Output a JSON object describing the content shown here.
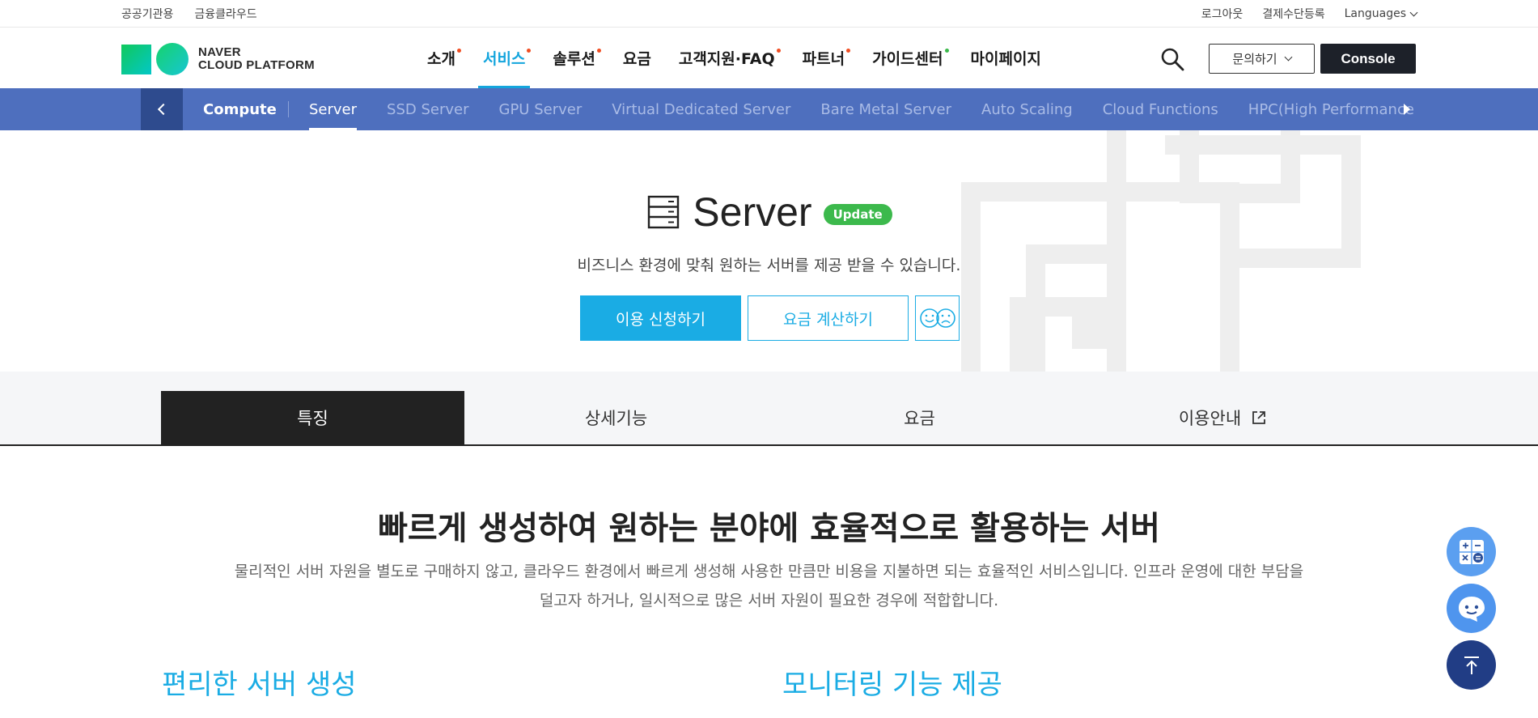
{
  "util": {
    "left": [
      "공공기관용",
      "금융클라우드"
    ],
    "right": [
      "로그아웃",
      "결제수단등록"
    ],
    "languages": "Languages"
  },
  "logo": {
    "line1": "NAVER",
    "line2": "CLOUD PLATFORM"
  },
  "gnb": [
    {
      "label": "소개",
      "dot": "#f04e23"
    },
    {
      "label": "서비스",
      "dot": "#f04e23",
      "active": true
    },
    {
      "label": "솔루션",
      "dot": "#f04e23"
    },
    {
      "label": "요금"
    },
    {
      "label": "고객지원·FAQ",
      "dot": "#f04e23"
    },
    {
      "label": "파트너",
      "dot": "#f04e23"
    },
    {
      "label": "가이드센터",
      "dot": "#3cb94c"
    },
    {
      "label": "마이페이지"
    }
  ],
  "header": {
    "inquiry": "문의하기",
    "console": "Console"
  },
  "subnav": {
    "category": "Compute",
    "items": [
      "Server",
      "SSD Server",
      "GPU Server",
      "Virtual Dedicated Server",
      "Bare Metal Server",
      "Auto Scaling",
      "Cloud Functions",
      "HPC(High Performance"
    ],
    "active": "Server"
  },
  "hero": {
    "title": "Server",
    "badge": "Update",
    "desc": "비즈니스 환경에 맞춰 원하는 서버를 제공 받을 수 있습니다.",
    "apply": "이용 신청하기",
    "calc": "요금 계산하기"
  },
  "tabs": [
    "특징",
    "상세기능",
    "요금",
    "이용안내"
  ],
  "content": {
    "headline": "빠르게 생성하여 원하는 분야에 효율적으로 활용하는 서버",
    "lead": "물리적인 서버 자원을 별도로 구매하지 않고, 클라우드 환경에서 빠르게 생성해 사용한 만큼만 비용을 지불하면 되는 효율적인 서비스입니다. 인프라 운영에 대한 부담을 덜고자 하거나, 일시적으로 많은 서버 자원이 필요한 경우에 적합합니다.",
    "sub1": "편리한 서버 생성",
    "sub2": "모니터링 기능 제공"
  },
  "colors": {
    "accent": "#1aace4",
    "subnav": "#4e6fbe",
    "badge": "#3cb94c"
  },
  "icons": {
    "search": "search-icon",
    "server": "server-icon",
    "external": "external-link-icon",
    "calculator": "calculator-icon",
    "chatbot": "chatbot-icon",
    "top": "arrow-up-icon"
  }
}
